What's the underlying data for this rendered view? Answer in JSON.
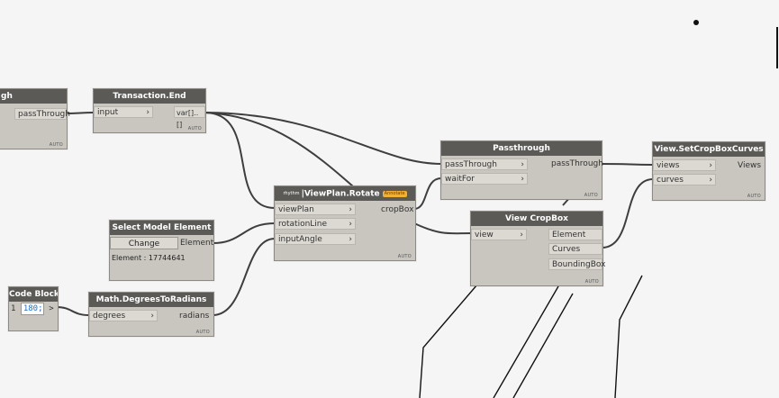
{
  "nodes": {
    "passthrough_left": {
      "title": "gh",
      "output": "passThrough",
      "auto": "AUTO"
    },
    "transaction_end": {
      "title": "Transaction.End",
      "input": "input",
      "output": "var[]..[]",
      "auto": "AUTO"
    },
    "viewplan_rotate": {
      "title": "ViewPlan.Rotate",
      "package_tag": "rhythm",
      "badge": "Annotate",
      "inputs": [
        "viewPlan",
        "rotationLine",
        "inputAngle"
      ],
      "output": "cropBox",
      "auto": "AUTO"
    },
    "select_model_element": {
      "title": "Select Model Element",
      "button": "Change",
      "output": "Element",
      "info": "Element : 17744641"
    },
    "code_block": {
      "title": "Code Block",
      "line_number": "1",
      "code": "180;",
      "output": ">"
    },
    "degrees_to_radians": {
      "title": "Math.DegreesToRadians",
      "input": "degrees",
      "output": "radians",
      "auto": "AUTO"
    },
    "passthrough_right": {
      "title": "Passthrough",
      "inputs": [
        "passThrough",
        "waitFor"
      ],
      "output": "passThrough",
      "auto": "AUTO"
    },
    "view_cropbox": {
      "title": "View CropBox",
      "input": "view",
      "outputs": [
        "Element",
        "Curves",
        "BoundingBox"
      ],
      "auto": "AUTO"
    },
    "set_cropbox_curves": {
      "title": "View.SetCropBoxCurves",
      "inputs": [
        "views",
        "curves"
      ],
      "output": "Views",
      "auto": "AUTO"
    }
  },
  "colors": {
    "canvas": "#f5f5f5",
    "node_header": "#5b5a57",
    "node_body": "#c9c6bf",
    "wire": "#3e3e3e",
    "code_value": "#1a6fd6",
    "badge": "#f2b035"
  }
}
